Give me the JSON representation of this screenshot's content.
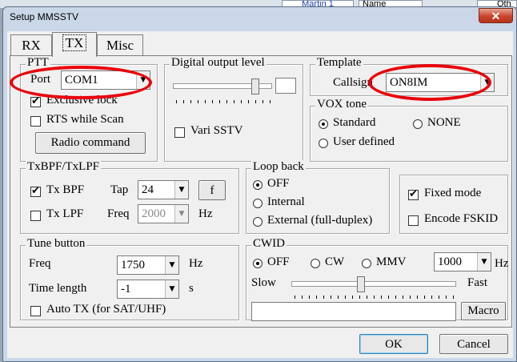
{
  "background": {
    "cell_marin": "Martin 1",
    "cell_name": "Name",
    "cell_qth": "Qth"
  },
  "window": {
    "title": "Setup MMSSTV",
    "close_glyph": "✕"
  },
  "tabs": [
    {
      "label": "RX"
    },
    {
      "label": "TX"
    },
    {
      "label": "Misc"
    }
  ],
  "ptt": {
    "legend": "PTT",
    "port_label": "Port",
    "port_value": "COM1",
    "exclusive_lock": "Exclusive lock",
    "rts_while_scan": "RTS while Scan",
    "radio_command": "Radio command"
  },
  "digital_output": {
    "legend": "Digital output level",
    "vari_sstv": "Vari SSTV",
    "level": 0.83
  },
  "template": {
    "legend": "Template",
    "callsign_label": "Callsign",
    "callsign_value": "ON8IM"
  },
  "vox": {
    "legend": "VOX tone",
    "standard": "Standard",
    "none": "NONE",
    "user_defined": "User defined"
  },
  "txbpf": {
    "legend": "TxBPF/TxLPF",
    "tx_bpf": "Tx BPF",
    "tap_label": "Tap",
    "tap_value": "24",
    "f_button": "f",
    "tx_lpf": "Tx LPF",
    "freq_label": "Freq",
    "freq_value": "2000",
    "hz": "Hz"
  },
  "loopback": {
    "legend": "Loop back",
    "off": "OFF",
    "internal": "Internal",
    "external": "External (full-duplex)"
  },
  "mode": {
    "fixed_mode": "Fixed mode",
    "encode_fskid": "Encode FSKID"
  },
  "tune": {
    "legend": "Tune button",
    "freq_label": "Freq",
    "freq_value": "1750",
    "hz": "Hz",
    "time_label": "Time length",
    "time_value": "-1",
    "s": "s",
    "auto_tx": "Auto TX (for SAT/UHF)"
  },
  "cwid": {
    "legend": "CWID",
    "off": "OFF",
    "cw": "CW",
    "mmv": "MMV",
    "speed_value": "1000",
    "hz": "Hz",
    "slow": "Slow",
    "fast": "Fast",
    "speed_level": 0.42,
    "text_value": "",
    "macro_button": "Macro"
  },
  "footer": {
    "ok": "OK",
    "cancel": "Cancel"
  },
  "colors": {
    "annotation": "#e8000b",
    "window_frame": "#c9d7e8",
    "close": "#c7442b"
  },
  "checkmark": "✔"
}
